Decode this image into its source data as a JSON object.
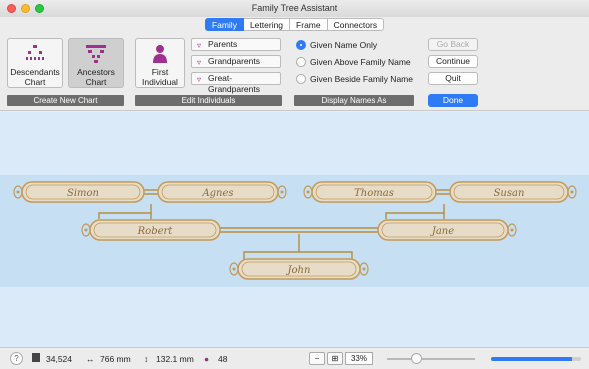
{
  "window": {
    "title": "Family Tree Assistant"
  },
  "tabs": [
    {
      "label": "Family",
      "active": true
    },
    {
      "label": "Lettering",
      "active": false
    },
    {
      "label": "Frame",
      "active": false
    },
    {
      "label": "Connectors",
      "active": false
    }
  ],
  "chart_buttons": {
    "descendants": {
      "label_line1": "Descendants",
      "label_line2": "Chart"
    },
    "ancestors": {
      "label_line1": "Ancestors",
      "label_line2": "Chart"
    },
    "section_label": "Create New Chart"
  },
  "edit": {
    "first_individual": {
      "label_line1": "First",
      "label_line2": "Individual"
    },
    "buttons": [
      "Parents",
      "Grandparents",
      "Great-Grandparents"
    ],
    "section_label": "Edit Individuals"
  },
  "display": {
    "options": [
      {
        "label": "Given Name Only",
        "selected": true
      },
      {
        "label": "Given Above Family Name",
        "selected": false
      },
      {
        "label": "Given Beside Family Name",
        "selected": false
      }
    ],
    "section_label": "Display Names As"
  },
  "actions": {
    "go_back": "Go Back",
    "continue": "Continue",
    "quit": "Quit",
    "done": "Done"
  },
  "tree": {
    "grandparents": [
      "Simon",
      "Agnes",
      "Thomas",
      "Susan"
    ],
    "parents": [
      "Robert",
      "Jane"
    ],
    "child": "John"
  },
  "status": {
    "stitches": "34,524",
    "width": "766 mm",
    "height": "132.1 mm",
    "colors": "48",
    "zoom": "33%",
    "zoom_level": 0.33,
    "progress": 0.9
  },
  "colors": {
    "accent": "#2f7bf6",
    "frame": "#c29a5a",
    "connector": "#b58d3c",
    "name_text": "#8a6a3a",
    "icon": "#a0308f"
  }
}
